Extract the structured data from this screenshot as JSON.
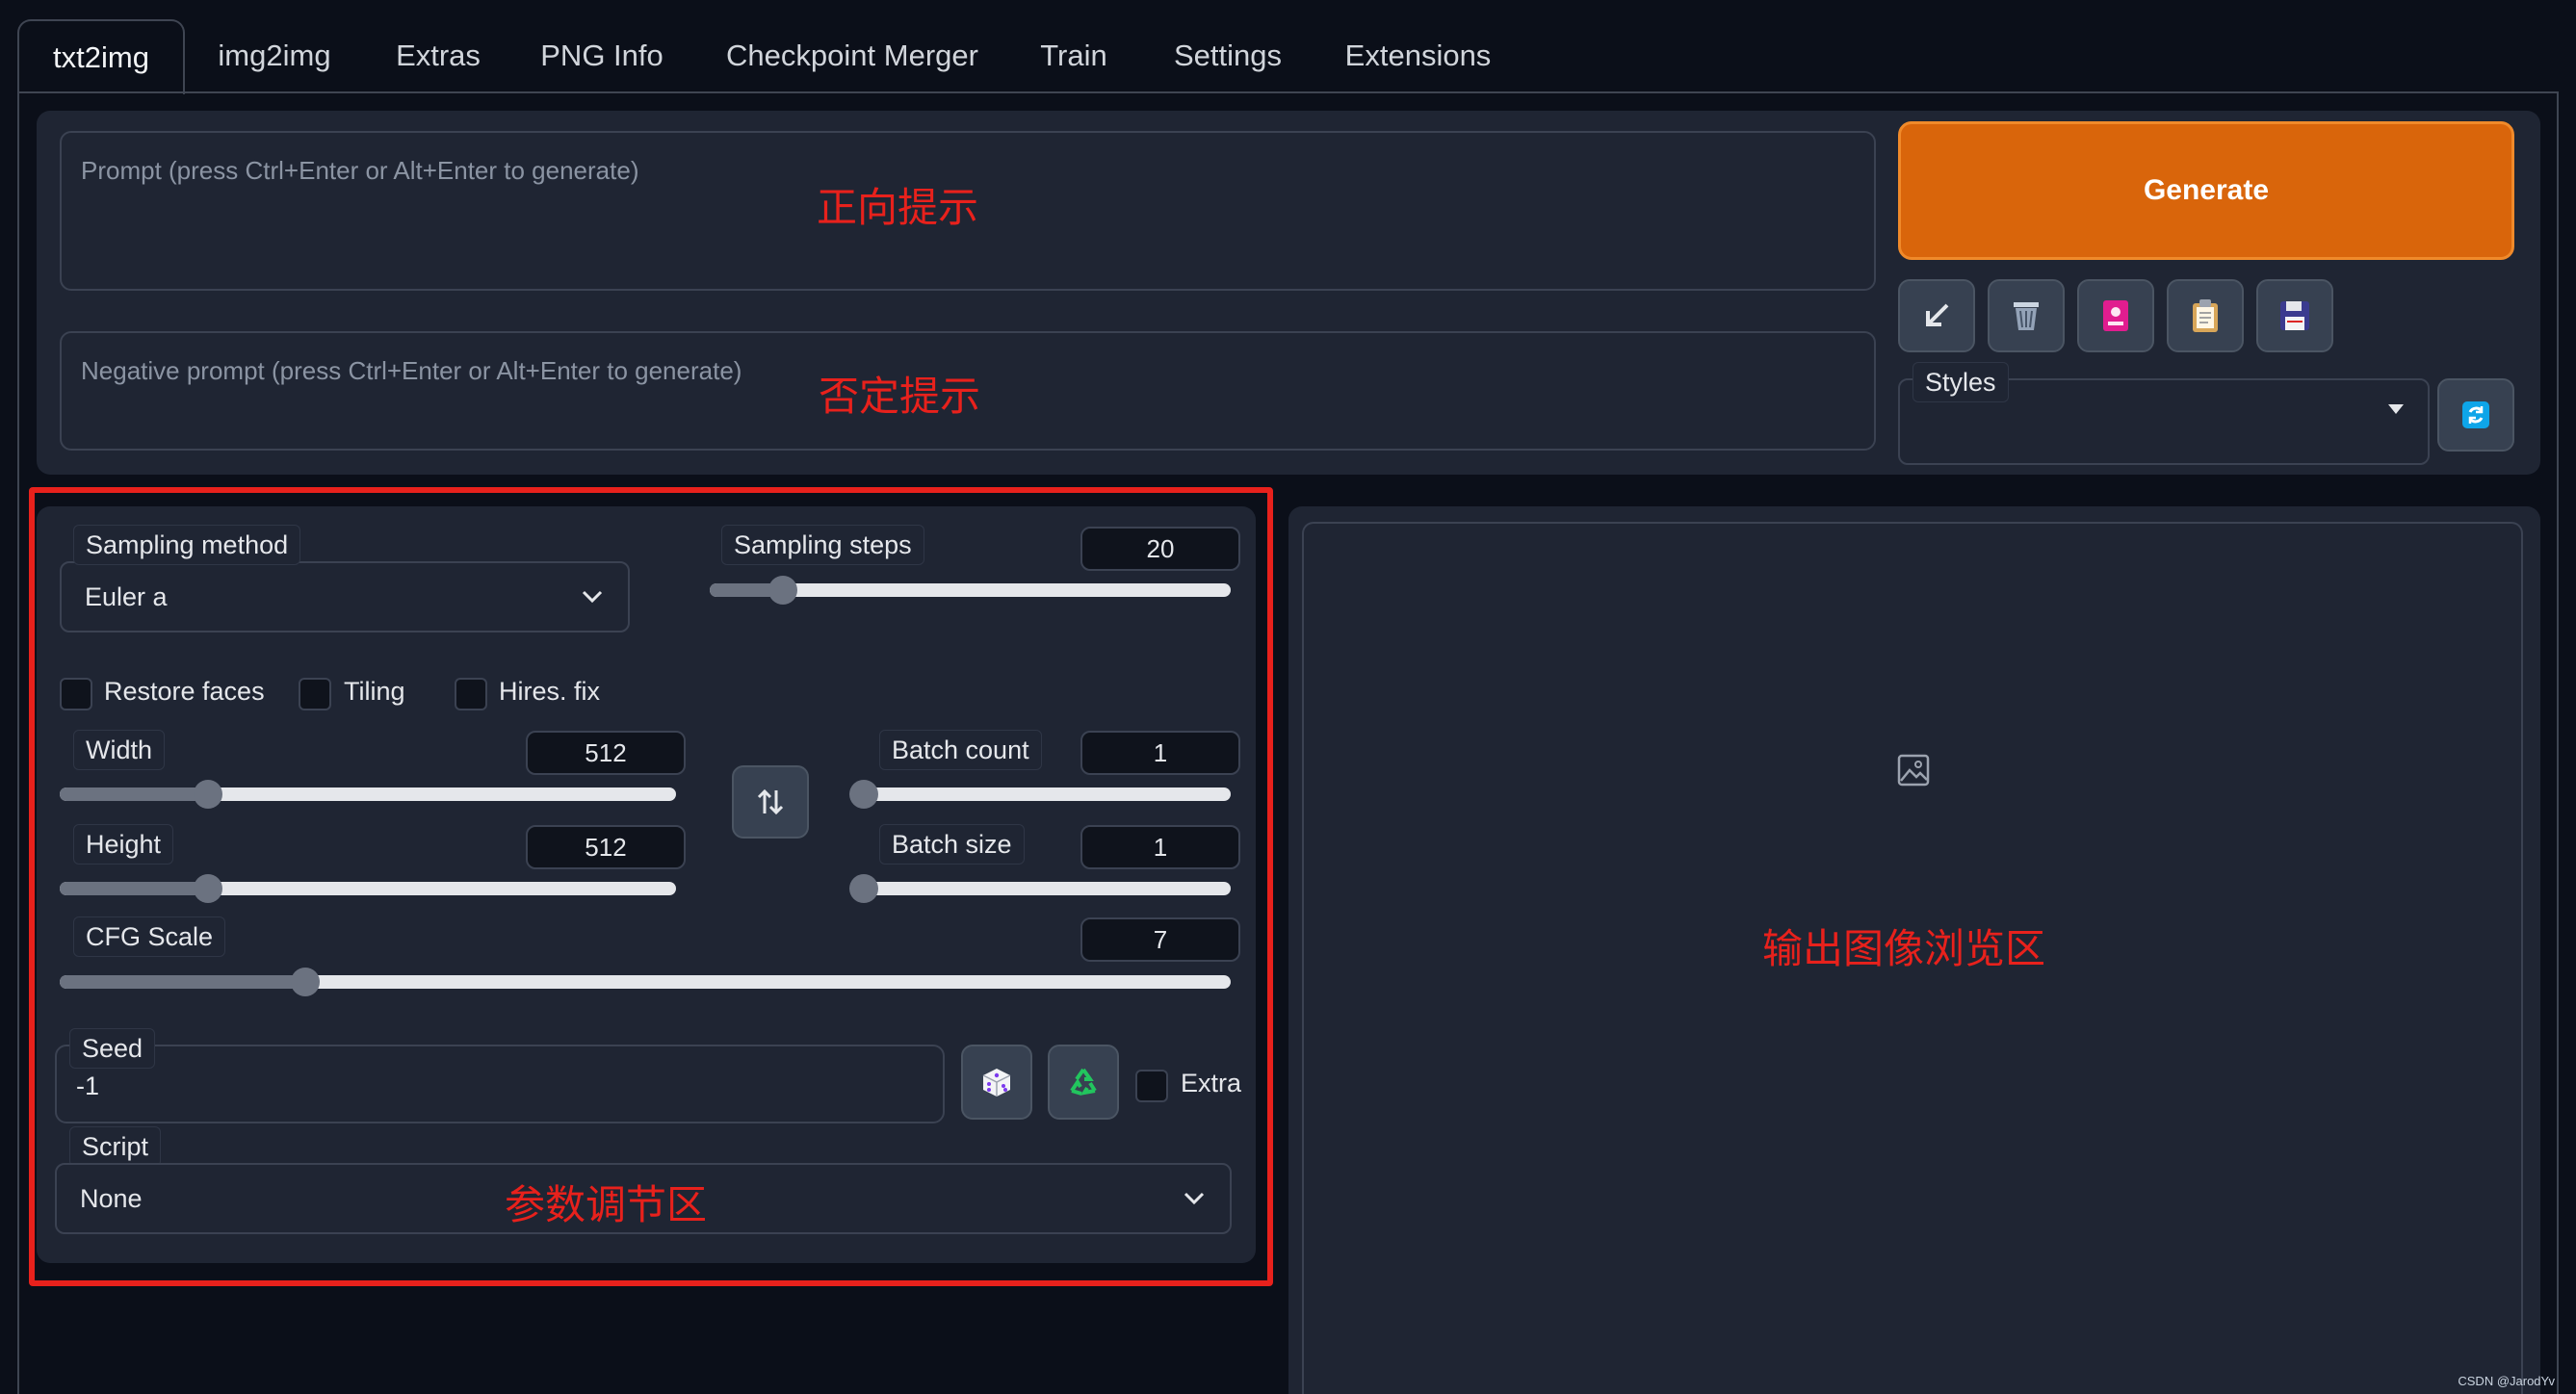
{
  "tabs": [
    {
      "label": "txt2img",
      "active": true
    },
    {
      "label": "img2img"
    },
    {
      "label": "Extras"
    },
    {
      "label": "PNG Info"
    },
    {
      "label": "Checkpoint Merger"
    },
    {
      "label": "Train"
    },
    {
      "label": "Settings"
    },
    {
      "label": "Extensions"
    }
  ],
  "prompt": {
    "placeholder": "Prompt (press Ctrl+Enter or Alt+Enter to generate)",
    "annotation": "正向提示"
  },
  "negative_prompt": {
    "placeholder": "Negative prompt (press Ctrl+Enter or Alt+Enter to generate)",
    "annotation": "否定提示"
  },
  "generate": {
    "label": "Generate",
    "color": "#d9650b"
  },
  "tool_buttons": [
    "arrow-icon",
    "trash-icon",
    "card-icon",
    "clipboard-icon",
    "floppy-disk-icon"
  ],
  "styles": {
    "label": "Styles"
  },
  "params": {
    "sampling_method": {
      "label": "Sampling method",
      "value": "Euler a"
    },
    "sampling_steps": {
      "label": "Sampling steps",
      "value": "20",
      "fraction": 0.14
    },
    "restore_faces": {
      "label": "Restore faces",
      "checked": false
    },
    "tiling": {
      "label": "Tiling",
      "checked": false
    },
    "hires_fix": {
      "label": "Hires. fix",
      "checked": false
    },
    "width": {
      "label": "Width",
      "value": "512",
      "fraction": 0.24
    },
    "height": {
      "label": "Height",
      "value": "512",
      "fraction": 0.24
    },
    "batch_count": {
      "label": "Batch count",
      "value": "1",
      "fraction": 0.0
    },
    "batch_size": {
      "label": "Batch size",
      "value": "1",
      "fraction": 0.0
    },
    "cfg_scale": {
      "label": "CFG Scale",
      "value": "7",
      "fraction": 0.21
    },
    "seed": {
      "label": "Seed",
      "value": "-1"
    },
    "extra": {
      "label": "Extra",
      "checked": false
    },
    "script": {
      "label": "Script",
      "value": "None"
    },
    "annotation": "参数调节区"
  },
  "output": {
    "annotation": "输出图像浏览区"
  },
  "watermark": "CSDN @JarodYv",
  "highlight_color": "#e8211c"
}
